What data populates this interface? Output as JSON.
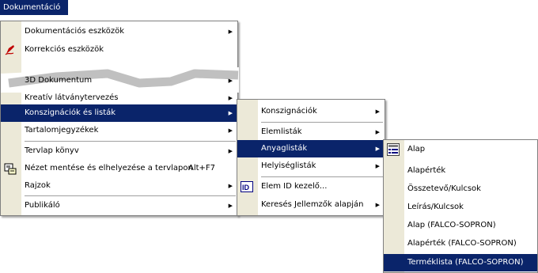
{
  "menubar": {
    "title": "Dokumentáció"
  },
  "menu1": {
    "items": [
      {
        "label": "Dokumentációs eszközök",
        "submenu": true
      },
      {
        "label": "Korrekciós eszközök",
        "submenu": false,
        "icon": "pencil-icon"
      },
      {
        "label": "3D Dokumentum",
        "submenu": true
      },
      {
        "label": "Kreatív látványtervezés",
        "submenu": true
      },
      {
        "label": "Konszignációk és listák",
        "submenu": true,
        "highlighted": true
      },
      {
        "label": "Tartalomjegyzékek",
        "submenu": true
      },
      {
        "label": "Tervlap könyv",
        "submenu": true
      },
      {
        "label": "Nézet mentése és elhelyezése a tervlapon",
        "shortcut": "Alt+F7",
        "icon": "save-view-icon"
      },
      {
        "label": "Rajzok",
        "submenu": true
      },
      {
        "label": "Publikáló",
        "submenu": true
      }
    ]
  },
  "menu2": {
    "items": [
      {
        "label": "Konszignációk",
        "submenu": true
      },
      {
        "label": "Elemlisták",
        "submenu": true
      },
      {
        "label": "Anyaglisták",
        "submenu": true,
        "highlighted": true
      },
      {
        "label": "Helyiséglisták",
        "submenu": true
      },
      {
        "label": "Elem ID kezelő...",
        "icon": "element-id-icon"
      },
      {
        "label": "Keresés Jellemzők alapján",
        "submenu": true
      }
    ]
  },
  "menu3": {
    "items": [
      {
        "label": "Alap",
        "icon": "list-scheme-icon"
      },
      {
        "label": "Alapérték"
      },
      {
        "label": "Összetevő/Kulcsok"
      },
      {
        "label": "Leírás/Kulcsok"
      },
      {
        "label": "Alap (FALCO-SOPRON)"
      },
      {
        "label": "Alapérték (FALCO-SOPRON)"
      },
      {
        "label": "Terméklista (FALCO-SOPRON)",
        "highlighted": true
      }
    ]
  },
  "colors": {
    "highlight": "#0a246a",
    "gutter": "#ece9d8",
    "border": "#808080"
  }
}
